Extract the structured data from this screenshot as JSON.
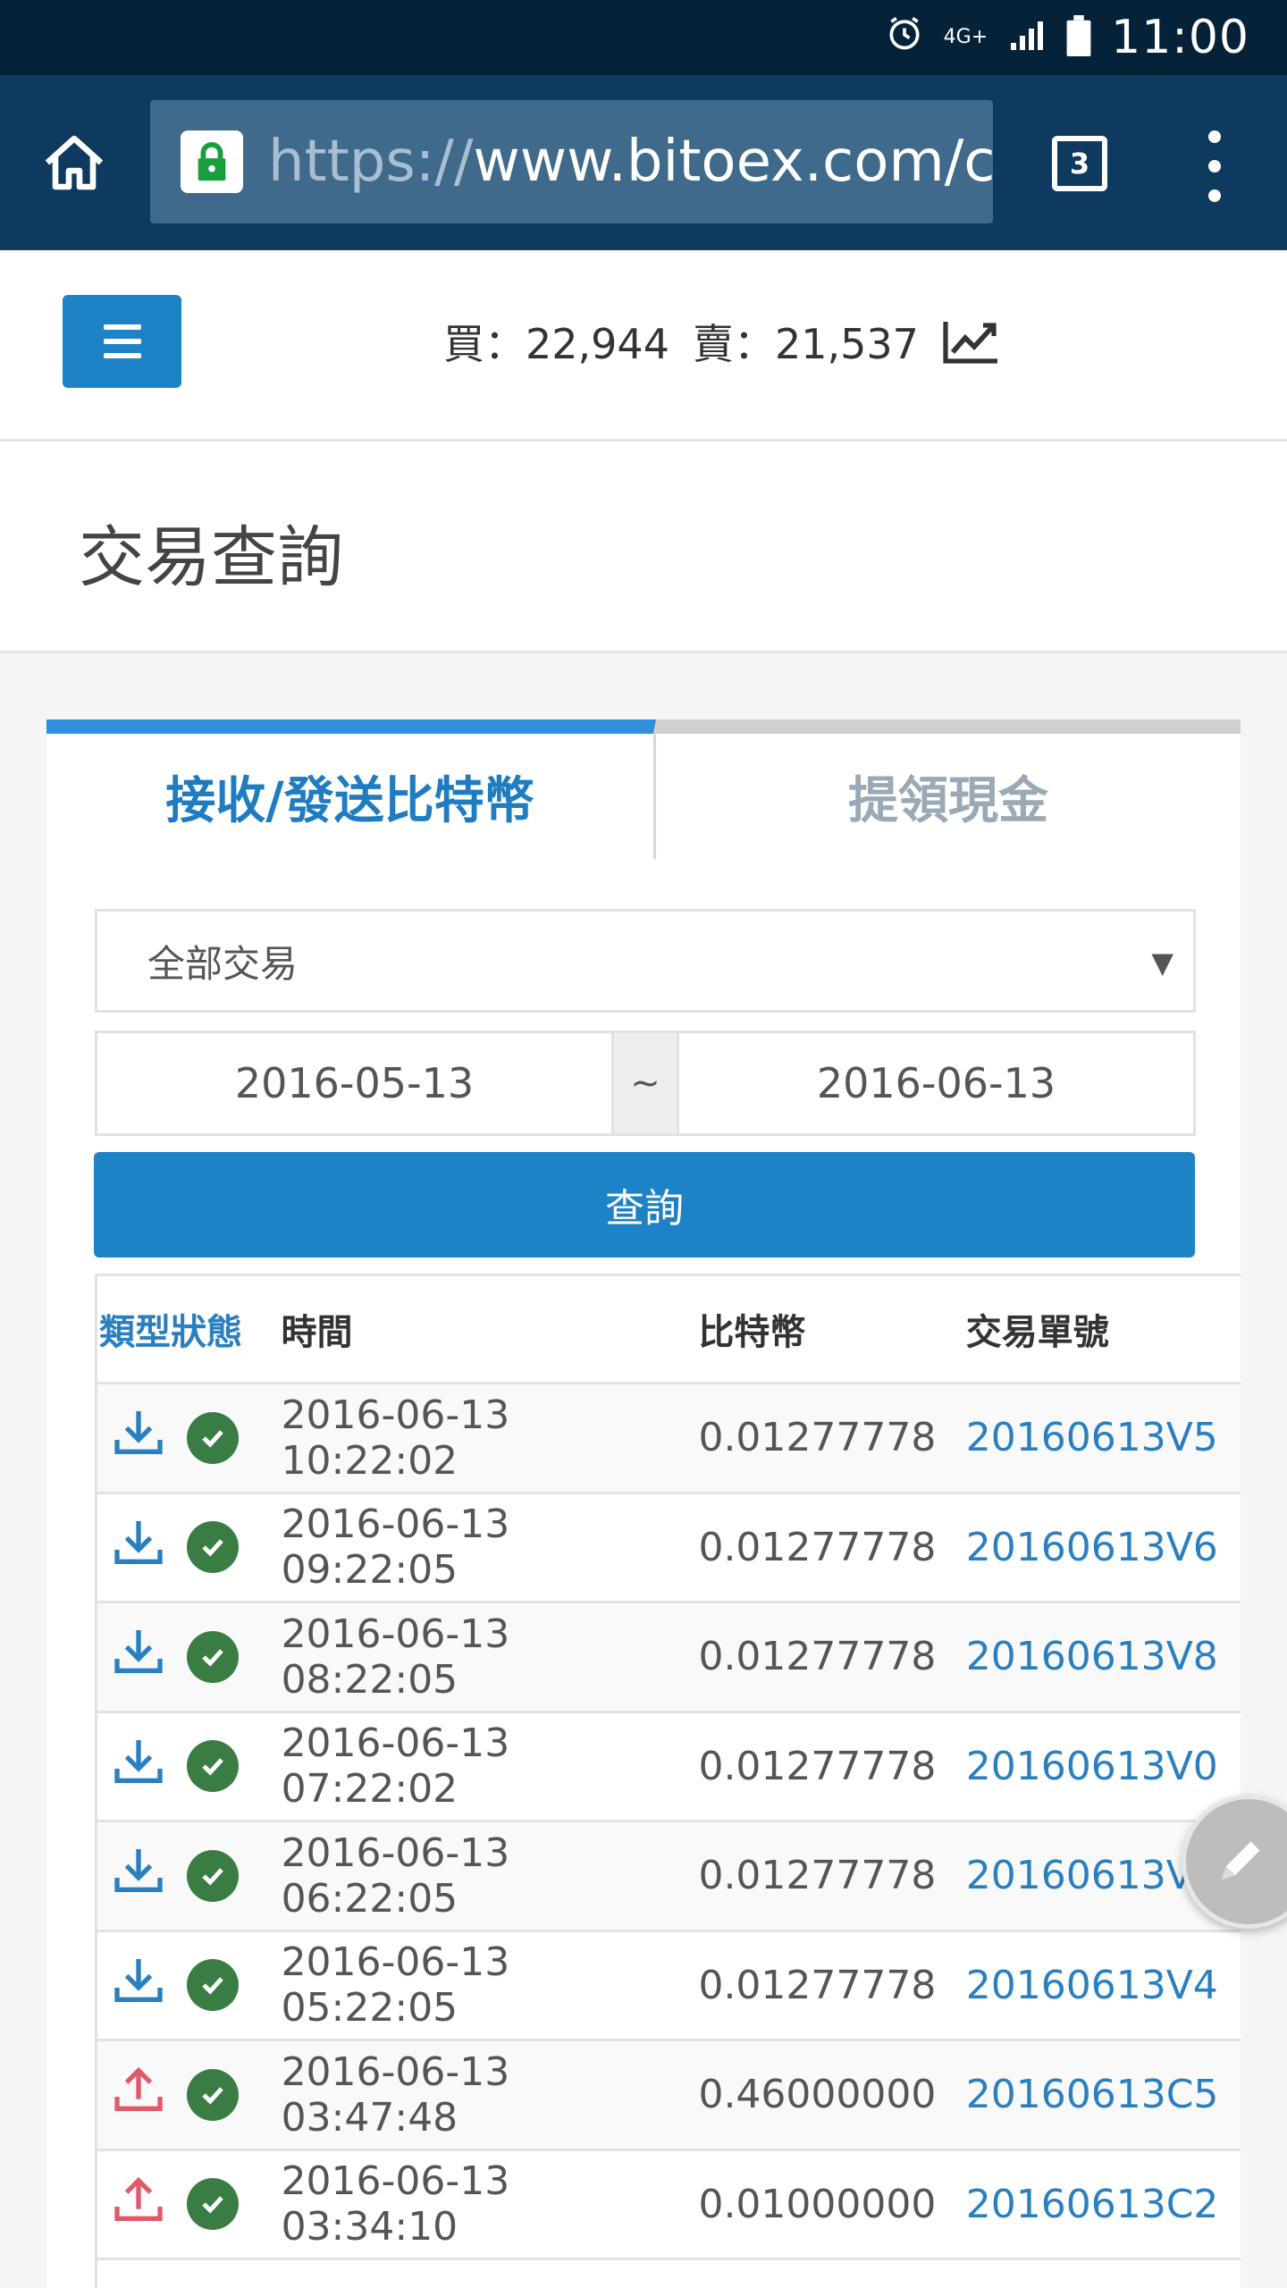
{
  "status_bar": {
    "time": "11:00",
    "network": "4G+"
  },
  "browser": {
    "url_scheme": "https://",
    "url_rest": "www.bitoex.com/c",
    "tab_count": "3"
  },
  "header": {
    "buy_label": "買：22,944",
    "sell_label": "賣：21,537"
  },
  "page_title": "交易查詢",
  "tabs": [
    {
      "label": "接收/發送比特幣",
      "active": true
    },
    {
      "label": "提領現金",
      "active": false
    }
  ],
  "filter": {
    "type_selected": "全部交易",
    "date_from": "2016-05-13",
    "date_sep": "~",
    "date_to": "2016-06-13",
    "query_label": "查詢"
  },
  "table": {
    "headers": [
      "類型狀態",
      "時間",
      "比特幣",
      "交易單號"
    ],
    "rows": [
      {
        "dir": "receive",
        "time": "2016-06-13 10:22:02",
        "btc": "0.01277778",
        "id": "20160613V5"
      },
      {
        "dir": "receive",
        "time": "2016-06-13 09:22:05",
        "btc": "0.01277778",
        "id": "20160613V6"
      },
      {
        "dir": "receive",
        "time": "2016-06-13 08:22:05",
        "btc": "0.01277778",
        "id": "20160613V8"
      },
      {
        "dir": "receive",
        "time": "2016-06-13 07:22:02",
        "btc": "0.01277778",
        "id": "20160613V0"
      },
      {
        "dir": "receive",
        "time": "2016-06-13 06:22:05",
        "btc": "0.01277778",
        "id": "20160613V2"
      },
      {
        "dir": "receive",
        "time": "2016-06-13 05:22:05",
        "btc": "0.01277778",
        "id": "20160613V4"
      },
      {
        "dir": "send",
        "time": "2016-06-13 03:47:48",
        "btc": "0.46000000",
        "id": "20160613C5"
      },
      {
        "dir": "send",
        "time": "2016-06-13 03:34:10",
        "btc": "0.01000000",
        "id": "20160613C2"
      }
    ]
  },
  "colors": {
    "accent": "#1e82c6",
    "receive_icon": "#2a7fc0",
    "send_icon": "#e05a6a",
    "status_ok": "#3a7d44"
  }
}
